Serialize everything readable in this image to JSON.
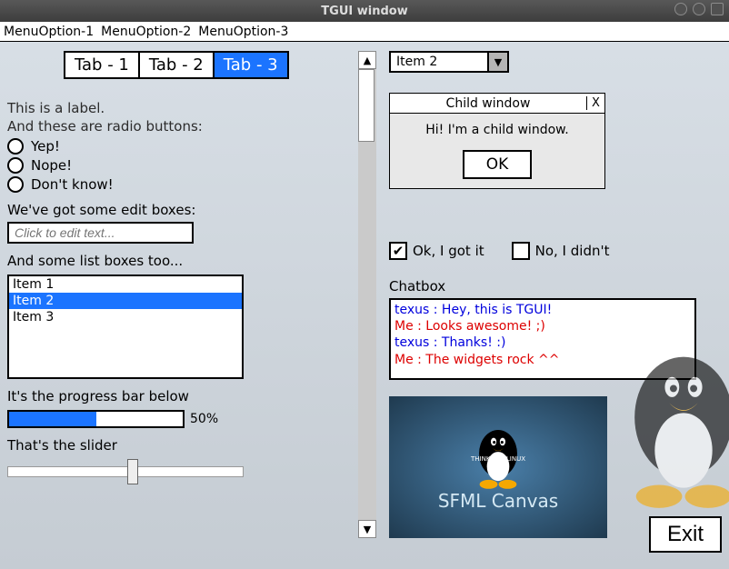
{
  "title": "TGUI window",
  "menubar": [
    "MenuOption-1",
    "MenuOption-2",
    "MenuOption-3"
  ],
  "tabs": [
    "Tab - 1",
    "Tab - 2",
    "Tab - 3"
  ],
  "tabs_selected": 2,
  "labelText": "This is a label.",
  "radioIntro": "And these are radio buttons:",
  "radios": [
    "Yep!",
    "Nope!",
    "Don't know!"
  ],
  "editLabel": "We've got some edit boxes:",
  "editPlaceholder": "Click to edit text...",
  "listLabel": "And some list boxes too...",
  "listItems": [
    "Item 1",
    "Item 2",
    "Item 3"
  ],
  "listSelected": 1,
  "progressLabel": "It's the progress bar below",
  "progressText": "50%",
  "sliderLabel": "That's the slider",
  "combo": "Item 2",
  "childWindow": {
    "title": "Child window",
    "body": "Hi! I'm a child window.",
    "ok": "OK",
    "close": "X"
  },
  "checks": [
    {
      "label": "Ok, I got it",
      "checked": true
    },
    {
      "label": "No, I didn't",
      "checked": false
    }
  ],
  "chatLabel": "Chatbox",
  "chat": [
    {
      "cls": "blue",
      "text": "texus : Hey, this is TGUI!"
    },
    {
      "cls": "red",
      "text": "Me : Looks awesome! ;)"
    },
    {
      "cls": "blue",
      "text": "texus : Thanks! :)"
    },
    {
      "cls": "red",
      "text": "Me : The widgets rock ^^"
    }
  ],
  "canvasLabel": "SFML Canvas",
  "canvasBanner": {
    "left": "THINK",
    "right": "LINUX"
  },
  "exit": "Exit"
}
